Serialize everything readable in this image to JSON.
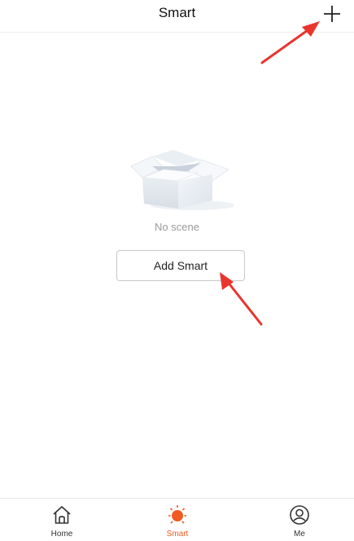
{
  "header": {
    "title": "Smart",
    "add_icon": "plus-icon"
  },
  "empty_state": {
    "illustration": "empty-box-illustration",
    "message": "No scene"
  },
  "actions": {
    "add_smart_label": "Add Smart"
  },
  "tabbar": {
    "tabs": [
      {
        "label": "Home",
        "icon": "home-icon",
        "active": false
      },
      {
        "label": "Smart",
        "icon": "sun-icon",
        "active": true
      },
      {
        "label": "Me",
        "icon": "user-icon",
        "active": false
      }
    ]
  },
  "colors": {
    "accent": "#f05a22",
    "annotation_arrow": "#e8352e"
  }
}
